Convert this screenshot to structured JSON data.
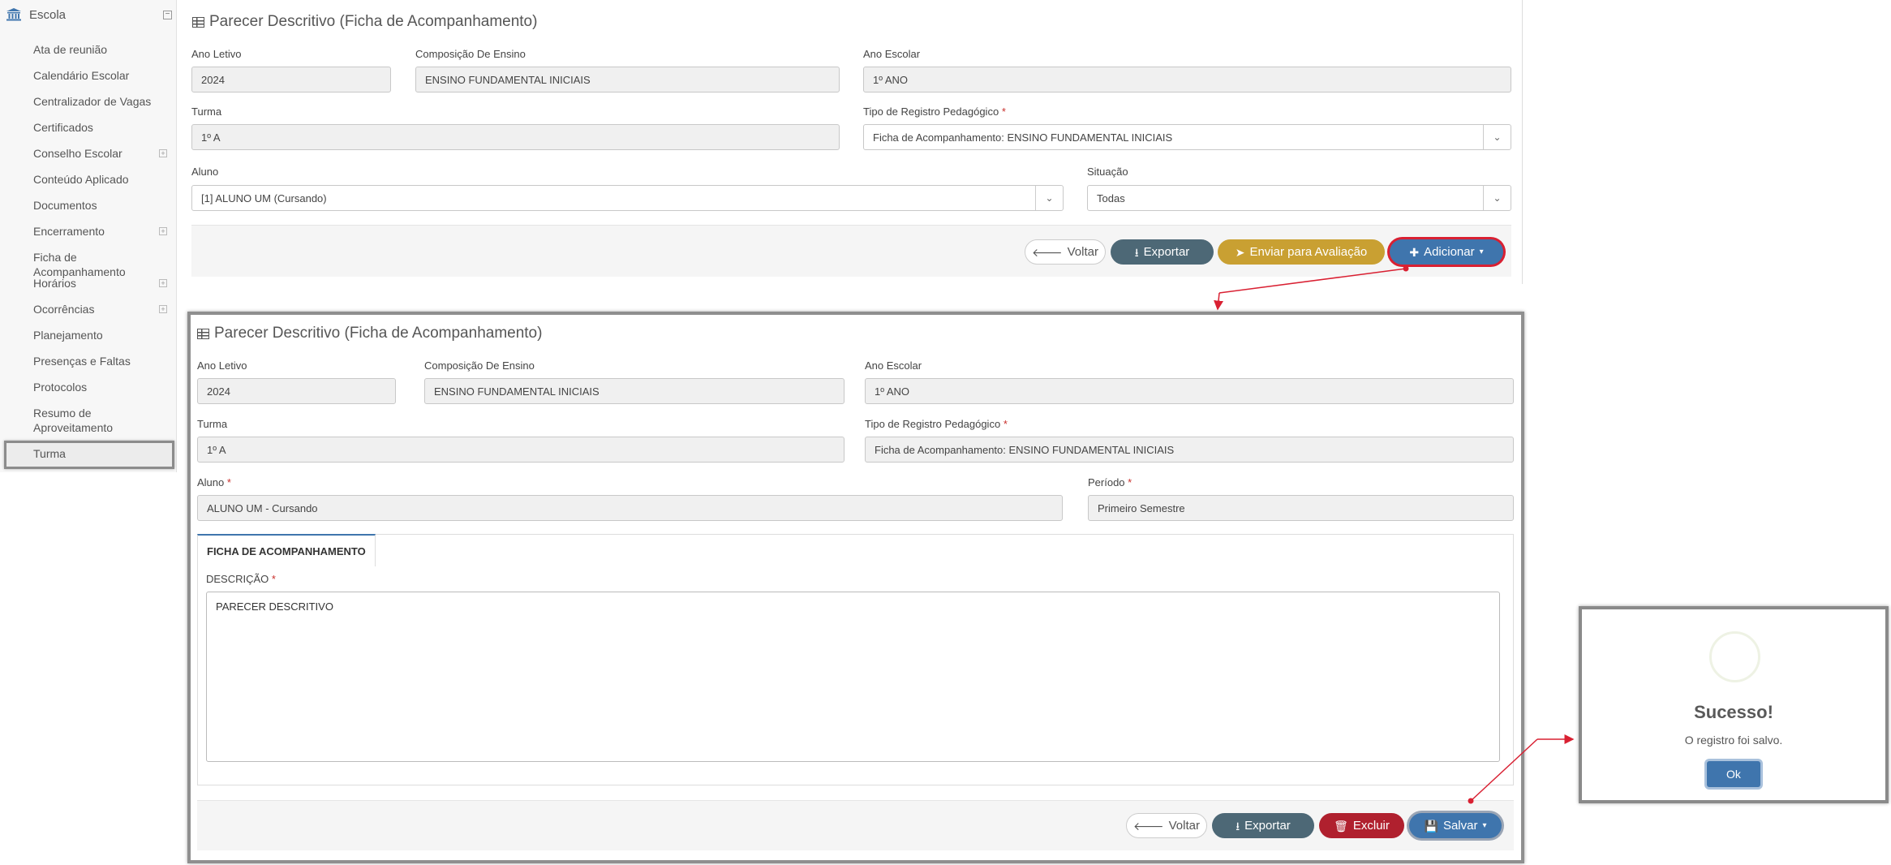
{
  "sidebar": {
    "header": "Escola",
    "items": [
      {
        "label": "Ata de reunião",
        "expandable": false
      },
      {
        "label": "Calendário Escolar",
        "expandable": false
      },
      {
        "label": "Centralizador de Vagas",
        "expandable": false
      },
      {
        "label": "Certificados",
        "expandable": false
      },
      {
        "label": "Conselho Escolar",
        "expandable": true
      },
      {
        "label": "Conteúdo Aplicado",
        "expandable": false
      },
      {
        "label": "Documentos",
        "expandable": false
      },
      {
        "label": "Encerramento",
        "expandable": true
      },
      {
        "label": "Ficha de Acompanhamento",
        "expandable": false
      },
      {
        "label": "Horários",
        "expandable": true
      },
      {
        "label": "Ocorrências",
        "expandable": true
      },
      {
        "label": "Planejamento",
        "expandable": false
      },
      {
        "label": "Presenças e Faltas",
        "expandable": false
      },
      {
        "label": "Protocolos",
        "expandable": false
      },
      {
        "label": "Resumo de Aproveitamento",
        "expandable": false
      },
      {
        "label": "Turma",
        "expandable": false
      }
    ]
  },
  "panel1": {
    "title": "Parecer Descritivo (Ficha de Acompanhamento)",
    "ano_letivo": {
      "label": "Ano Letivo",
      "value": "2024"
    },
    "composicao": {
      "label": "Composição De Ensino",
      "value": "ENSINO FUNDAMENTAL INICIAIS"
    },
    "ano_escolar": {
      "label": "Ano Escolar",
      "value": "1º ANO"
    },
    "turma": {
      "label": "Turma",
      "value": "1º A"
    },
    "tipo_registro": {
      "label": "Tipo de Registro Pedagógico",
      "value": "Ficha de Acompanhamento: ENSINO FUNDAMENTAL INICIAIS"
    },
    "aluno": {
      "label": "Aluno",
      "value": "[1] ALUNO UM (Cursando)"
    },
    "situacao": {
      "label": "Situação",
      "value": "Todas"
    },
    "buttons": {
      "voltar": "Voltar",
      "exportar": "Exportar",
      "enviar": "Enviar para Avaliação",
      "adicionar": "Adicionar"
    }
  },
  "panel2": {
    "title": "Parecer Descritivo (Ficha de Acompanhamento)",
    "ano_letivo": {
      "label": "Ano Letivo",
      "value": "2024"
    },
    "composicao": {
      "label": "Composição De Ensino",
      "value": "ENSINO FUNDAMENTAL INICIAIS"
    },
    "ano_escolar": {
      "label": "Ano Escolar",
      "value": "1º ANO"
    },
    "turma": {
      "label": "Turma",
      "value": "1º A"
    },
    "tipo_registro": {
      "label": "Tipo de Registro Pedagógico",
      "value": "Ficha de Acompanhamento: ENSINO FUNDAMENTAL INICIAIS"
    },
    "aluno": {
      "label": "Aluno",
      "value": "ALUNO UM - Cursando"
    },
    "periodo": {
      "label": "Período",
      "value": "Primeiro Semestre"
    },
    "tab": "FICHA DE ACOMPANHAMENTO",
    "descricao": {
      "label": "DESCRIÇÃO",
      "value": "PARECER DESCRITIVO"
    },
    "buttons": {
      "voltar": "Voltar",
      "exportar": "Exportar",
      "excluir": "Excluir",
      "salvar": "Salvar"
    }
  },
  "modal": {
    "title": "Sucesso!",
    "message": "O registro foi salvo.",
    "ok": "Ok"
  },
  "colors": {
    "primary": "#3f75ad",
    "slate": "#4d6876",
    "gold": "#c9a032",
    "danger": "#b0202e",
    "annotation": "#d92032"
  }
}
